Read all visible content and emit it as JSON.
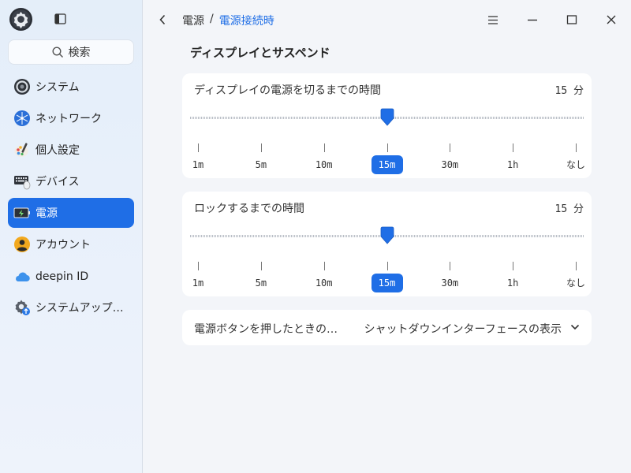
{
  "sidebar": {
    "search_label": "検索",
    "items": [
      {
        "label": "システム",
        "icon": "system-icon"
      },
      {
        "label": "ネットワーク",
        "icon": "network-icon"
      },
      {
        "label": "個人設定",
        "icon": "personalization-icon"
      },
      {
        "label": "デバイス",
        "icon": "devices-icon"
      },
      {
        "label": "電源",
        "icon": "power-icon",
        "active": true
      },
      {
        "label": "アカウント",
        "icon": "account-icon"
      },
      {
        "label": "deepin ID",
        "icon": "cloud-icon"
      },
      {
        "label": "システムアップデート",
        "icon": "update-icon"
      }
    ]
  },
  "header": {
    "breadcrumb_parent": "電源",
    "breadcrumb_sep": "/",
    "breadcrumb_current": "電源接続時"
  },
  "section": {
    "title": "ディスプレイとサスペンド"
  },
  "display_off": {
    "label": "ディスプレイの電源を切るまでの時間",
    "value": "15 分",
    "ticks": [
      "1m",
      "5m",
      "10m",
      "15m",
      "30m",
      "1h",
      "なし"
    ],
    "selected_index": 3
  },
  "lock": {
    "label": "ロックするまでの時間",
    "value": "15 分",
    "ticks": [
      "1m",
      "5m",
      "10m",
      "15m",
      "30m",
      "1h",
      "なし"
    ],
    "selected_index": 3
  },
  "power_button": {
    "label": "電源ボタンを押したときの…",
    "value": "シャットダウンインターフェースの表示"
  },
  "colors": {
    "accent": "#1f6ee6"
  }
}
